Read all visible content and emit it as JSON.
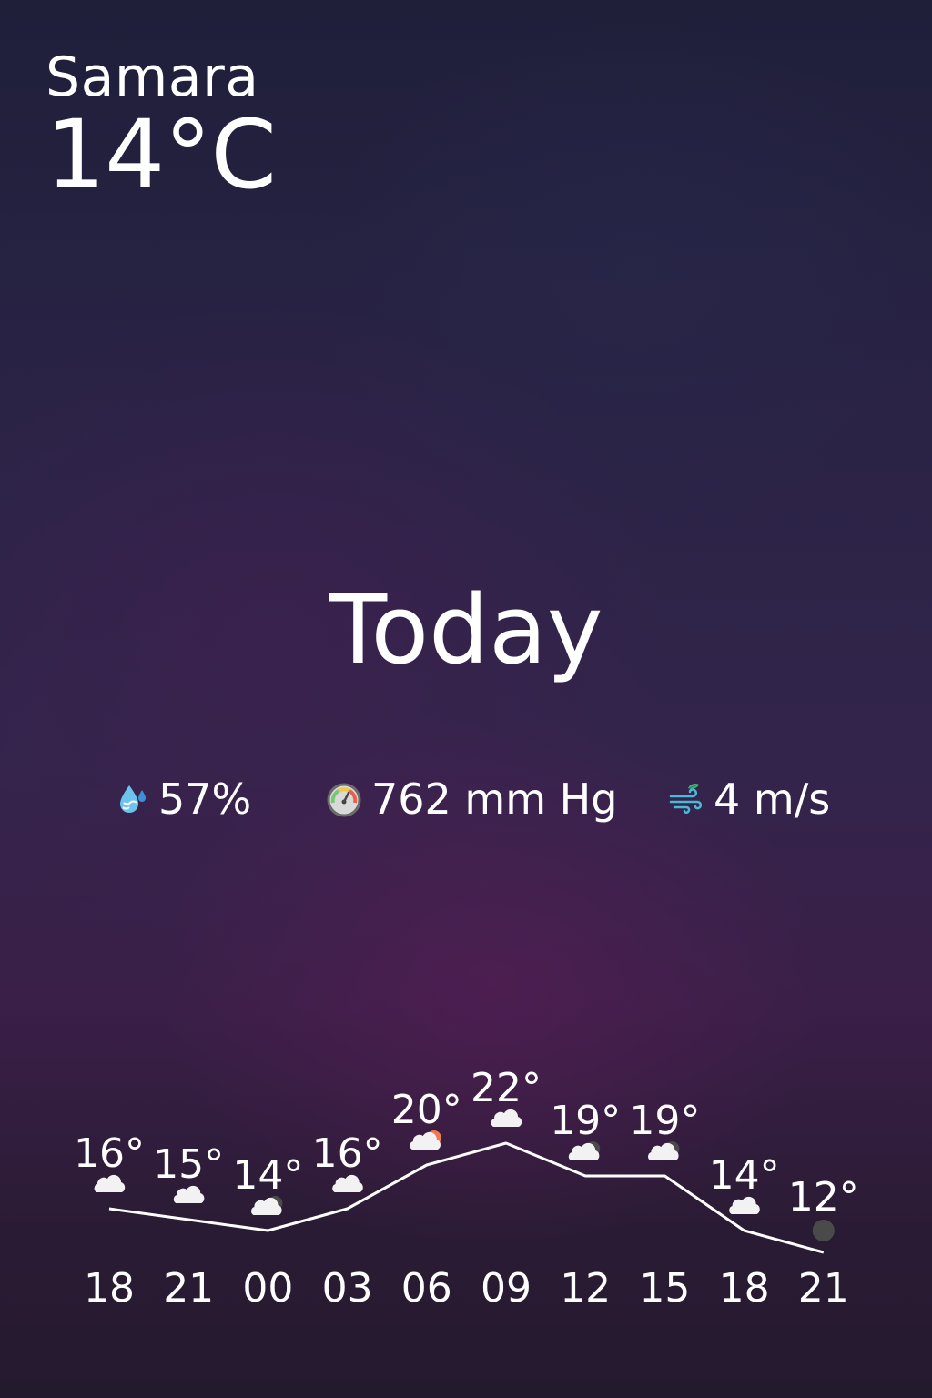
{
  "location": {
    "city": "Samara",
    "temperature": "14°C"
  },
  "day": {
    "title": "Today"
  },
  "stats": {
    "humidity": {
      "value": "57%",
      "icon": "humidity-drop-icon"
    },
    "pressure": {
      "value": "762 mm Hg",
      "icon": "gauge-icon"
    },
    "wind": {
      "value": "4 m/s",
      "icon": "wind-icon"
    }
  },
  "colors": {
    "text": "#ffffff",
    "cloud": "#f2f2f2",
    "sun": "#f07a50",
    "moon": "#4a4a4a"
  },
  "chart_data": {
    "type": "line",
    "x": [
      "18",
      "21",
      "00",
      "03",
      "06",
      "09",
      "12",
      "15",
      "18",
      "21"
    ],
    "series": [
      {
        "values": [
          16,
          15,
          14,
          16,
          20,
          22,
          19,
          19,
          14,
          12
        ]
      }
    ],
    "point_labels": [
      "16°",
      "15°",
      "14°",
      "16°",
      "20°",
      "22°",
      "19°",
      "19°",
      "14°",
      "12°"
    ],
    "conditions": [
      "cloudy",
      "cloudy",
      "cloudy-night",
      "cloudy",
      "partly-cloudy-day",
      "cloudy",
      "cloudy-night",
      "cloudy-night",
      "cloudy",
      "clear-night"
    ],
    "ylim": [
      12,
      22
    ],
    "grid": false
  }
}
